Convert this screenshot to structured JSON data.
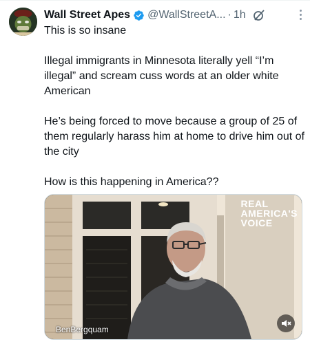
{
  "post": {
    "author_name": "Wall Street Apes",
    "handle": "@WallStreetA...",
    "separator": "·",
    "time": "1h",
    "text": {
      "line1": "This is so insane",
      "para1": "Illegal immigrants in Minnesota literally yell “I’m illegal” and scream cuss words at an older white American",
      "para2": "He’s being forced to move because a group of 25 of them regularly harass him at home to drive him out of the city",
      "para3": "How is this happening in America??"
    }
  },
  "media": {
    "watermark_lines": [
      "REAL",
      "AMERICA'S",
      "VOICE"
    ],
    "credit": "BenBergquam"
  },
  "icons": {
    "verified": "verified-badge-icon",
    "grok": "grok-icon",
    "more": "more-options-icon",
    "mute": "muted-speaker-icon"
  },
  "colors": {
    "verified": "#1d9bf0",
    "secondary_text": "#536471"
  }
}
